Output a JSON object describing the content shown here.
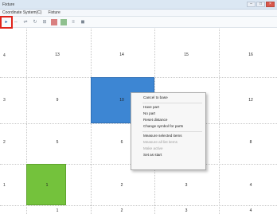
{
  "window": {
    "title": "Fixture",
    "controls": [
      "–",
      "□",
      "×"
    ]
  },
  "menu": [
    "Coordinate System(C)",
    "Fixture"
  ],
  "toolbar": {
    "tools": [
      {
        "icon": "pointer-icon",
        "glyph": "▸",
        "selected": true
      },
      {
        "icon": "move-icon",
        "glyph": "⇔",
        "selected": false
      },
      {
        "icon": "split-icon",
        "glyph": "⇌",
        "selected": false
      },
      {
        "icon": "rotate-icon",
        "glyph": "↻",
        "selected": false
      },
      {
        "icon": "grid-icon",
        "glyph": "⊞",
        "selected": false
      },
      {
        "icon": "color-red-icon",
        "glyph": "",
        "selected": false
      },
      {
        "icon": "color-green-icon",
        "glyph": "",
        "selected": false
      },
      {
        "icon": "align-icon",
        "glyph": "≡",
        "selected": false
      },
      {
        "icon": "camera-icon",
        "glyph": "◼",
        "selected": false
      }
    ]
  },
  "grid": {
    "row_labels": [
      "4",
      "3",
      "2",
      "1"
    ],
    "rows": [
      [
        "13",
        "14",
        "15",
        "16"
      ],
      [
        "9",
        "10",
        "11",
        "12"
      ],
      [
        "5",
        "6",
        "7",
        "8"
      ],
      [
        "1",
        "2",
        "3",
        "4"
      ]
    ],
    "bottom_labels": [
      "1",
      "2",
      "3",
      "4"
    ]
  },
  "context_menu": {
    "items": [
      {
        "label": "Cancel to base",
        "disabled": false,
        "sep_after": true
      },
      {
        "label": "Have part",
        "disabled": false,
        "sep_after": false
      },
      {
        "label": "No part",
        "disabled": false,
        "sep_after": false
      },
      {
        "label": "Reset distance",
        "disabled": false,
        "sep_after": false
      },
      {
        "label": "Change symbol for parts",
        "disabled": false,
        "sep_after": true
      },
      {
        "label": "Measure selected items",
        "disabled": false,
        "sep_after": false
      },
      {
        "label": "Measure all list items",
        "disabled": true,
        "sep_after": false
      },
      {
        "label": "Make active",
        "disabled": true,
        "sep_after": false
      },
      {
        "label": "Set as start",
        "disabled": false,
        "sep_after": false
      }
    ]
  },
  "colors": {
    "selected_cell": "#3d86d3",
    "start_cell": "#74c23c",
    "tool_highlight": "#e0241b"
  }
}
